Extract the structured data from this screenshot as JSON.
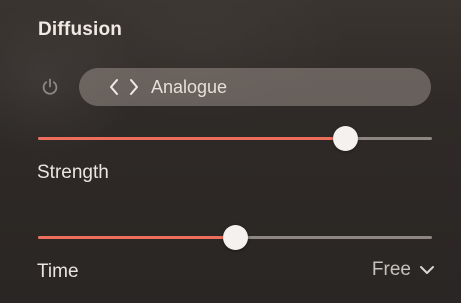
{
  "panel": {
    "title": "Diffusion"
  },
  "power": {
    "icon": "power-icon",
    "state": "on"
  },
  "preset": {
    "prev_icon": "chevron-left-icon",
    "next_icon": "chevron-right-icon",
    "name": "Analogue"
  },
  "strength": {
    "label": "Strength",
    "value_fraction": 0.78
  },
  "time": {
    "label": "Time",
    "value_fraction": 0.5,
    "mode": "Free",
    "mode_icon": "chevron-down-icon"
  },
  "colors": {
    "accent": "#ec6e5b",
    "track": "#8d8681",
    "thumb": "#f4f1ef",
    "background": "#2f2a27"
  }
}
